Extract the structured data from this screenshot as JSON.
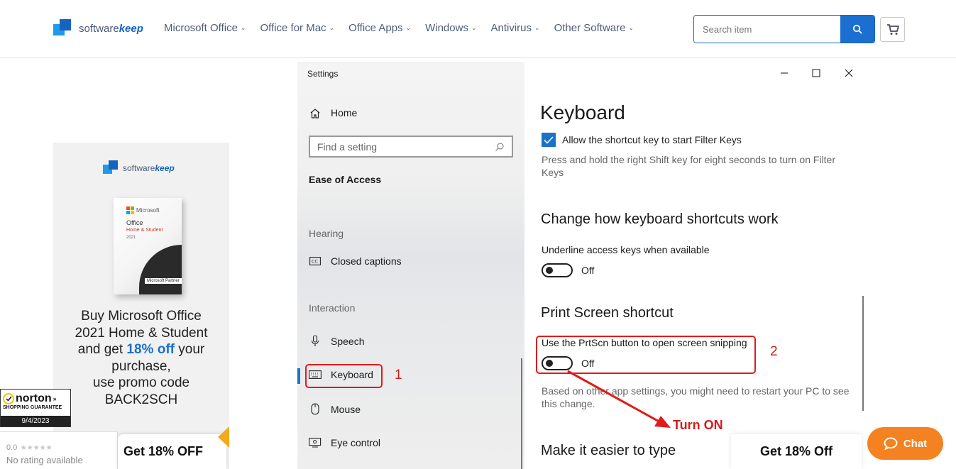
{
  "site": {
    "logo_prefix": "software",
    "logo_suffix": "keep",
    "nav": [
      "Microsoft Office",
      "Office for Mac",
      "Office Apps",
      "Windows",
      "Antivirus",
      "Other Software"
    ],
    "search_placeholder": "Search item"
  },
  "ad": {
    "logo_prefix": "software",
    "logo_suffix": "keep",
    "box_brand": "Microsoft",
    "box_product": "Office",
    "box_edition": "Home & Student",
    "box_year": "2021",
    "box_partner": "Microsoft Partner",
    "line1": "Buy Microsoft Office",
    "line2": "2021 Home & Student",
    "line3_pre": "and get ",
    "line3_hl": "18% off",
    "line3_post": " your",
    "line4": "purchase,",
    "line5": "use promo code",
    "line6": "BACK2SCH"
  },
  "settings": {
    "window_title": "Settings",
    "home": "Home",
    "find_placeholder": "Find a setting",
    "category": "Ease of Access",
    "groups": {
      "hearing": "Hearing",
      "interaction": "Interaction"
    },
    "items": {
      "closed_captions": "Closed captions",
      "speech": "Speech",
      "keyboard": "Keyboard",
      "mouse": "Mouse",
      "eye_control": "Eye control"
    },
    "page_title": "Keyboard",
    "filter_keys_checkbox": "Allow the shortcut key to start Filter Keys",
    "filter_keys_desc": "Press and hold the right Shift key for eight seconds to turn on Filter Keys",
    "section_shortcuts": "Change how keyboard shortcuts work",
    "underline_label": "Underline access keys when available",
    "underline_state": "Off",
    "section_printscreen": "Print Screen shortcut",
    "prtscn_label": "Use the PrtScn button to open screen snipping",
    "prtscn_state": "Off",
    "prtscn_desc": "Based on other app settings, you might need to restart your PC to see this change.",
    "section_type": "Make it easier to type"
  },
  "annotations": {
    "num1": "1",
    "num2": "2",
    "turn_on": "Turn ON"
  },
  "widgets": {
    "norton_name": "norton",
    "norton_sub": "SHOPPING GUARANTEE",
    "norton_date": "9/4/2023",
    "rating_value": "0.0",
    "rating_stars": "★★★★★",
    "rating_text": "No rating available",
    "promo_left": "Get 18% OFF",
    "promo_right": "Get 18% Off",
    "chat": "Chat"
  },
  "colors": {
    "brand_blue": "#1a6fd0",
    "windows_accent": "#1a73c8",
    "annotation_red": "#e11b1b",
    "chat_orange": "#f58220"
  }
}
